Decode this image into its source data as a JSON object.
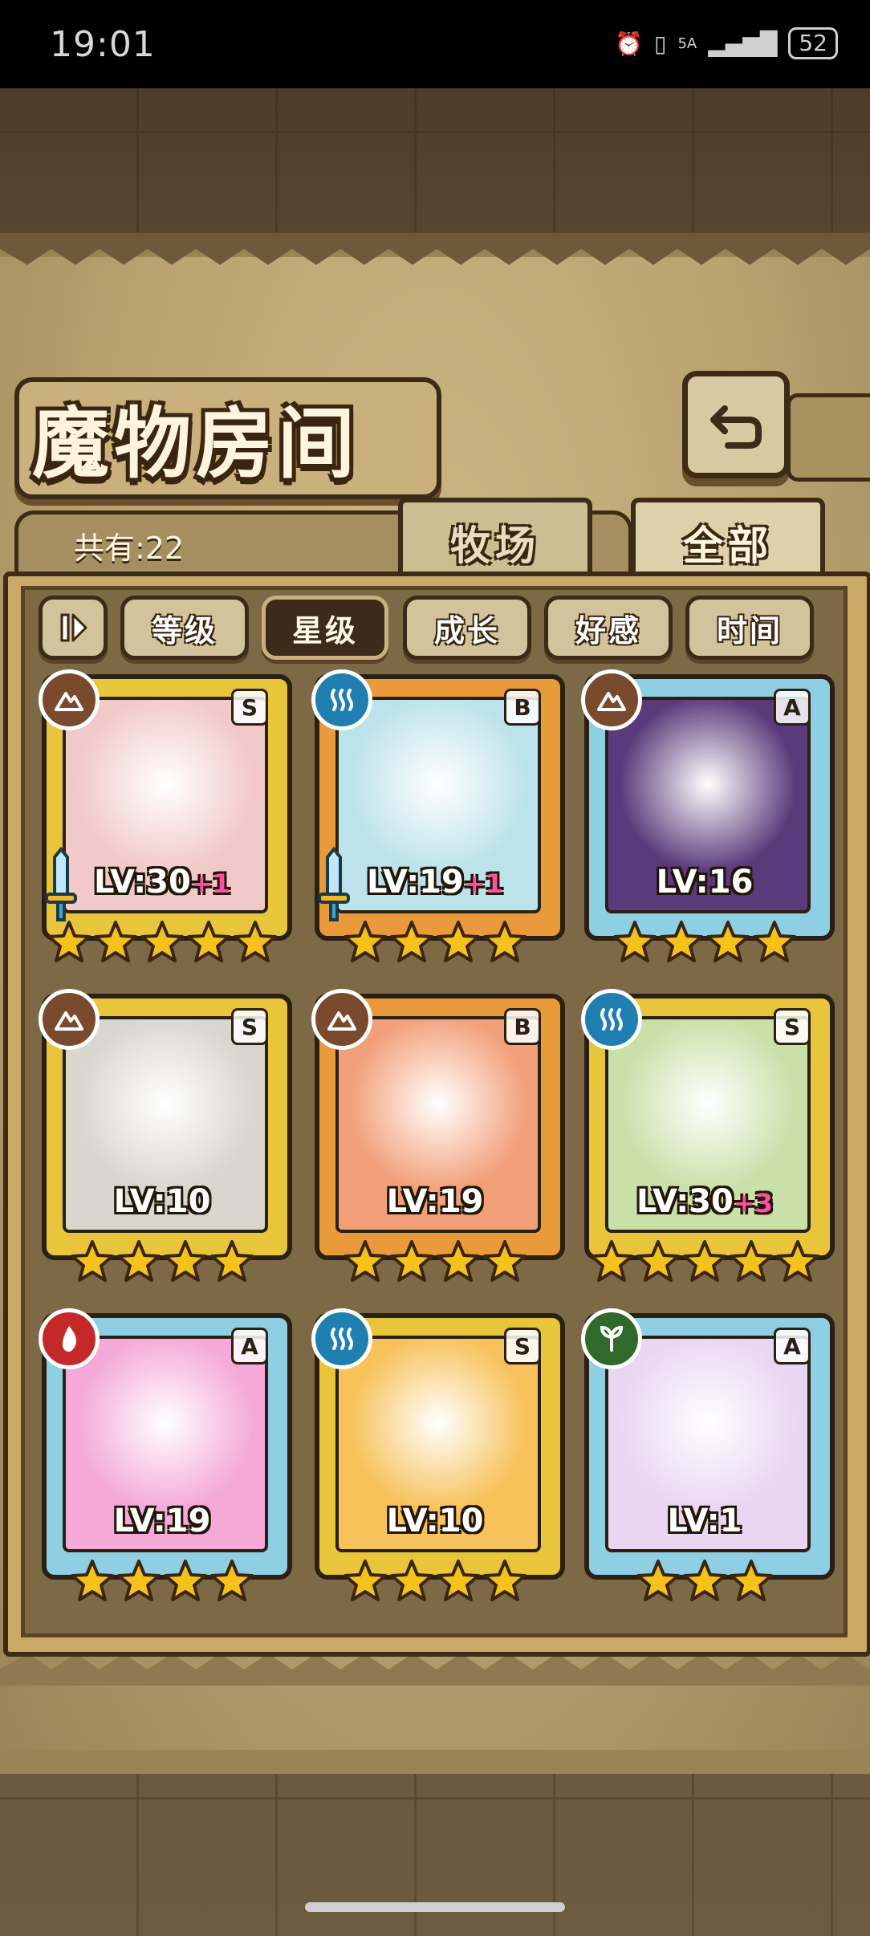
{
  "status_bar": {
    "time": "19:01",
    "network": "5A",
    "battery": "52"
  },
  "header": {
    "title": "魔物房间"
  },
  "summary": {
    "count_label": "共有:22"
  },
  "tabs": [
    {
      "label": "牧场",
      "active": false
    },
    {
      "label": "全部",
      "active": true
    }
  ],
  "sort": {
    "buttons": [
      {
        "label": "等级",
        "active": false
      },
      {
        "label": "星级",
        "active": true
      },
      {
        "label": "成长",
        "active": false
      },
      {
        "label": "好感",
        "active": false
      },
      {
        "label": "时间",
        "active": false
      }
    ]
  },
  "monsters": [
    {
      "level": "LV:30",
      "bonus": "+1",
      "rank": "S",
      "element": "earth",
      "stars": 5,
      "has_weapon": true,
      "frame_color": "#e8c53a",
      "art_color": "#f2c9c9"
    },
    {
      "level": "LV:19",
      "bonus": "+1",
      "rank": "B",
      "element": "water",
      "stars": 4,
      "has_weapon": true,
      "frame_color": "#e99a3a",
      "art_color": "#bde3ea"
    },
    {
      "level": "LV:16",
      "bonus": "",
      "rank": "A",
      "element": "earth",
      "stars": 4,
      "has_weapon": false,
      "frame_color": "#8fcfe3",
      "art_color": "#5a3a7a"
    },
    {
      "level": "LV:10",
      "bonus": "",
      "rank": "S",
      "element": "earth",
      "stars": 4,
      "has_weapon": false,
      "frame_color": "#e8c53a",
      "art_color": "#d9d6cf"
    },
    {
      "level": "LV:19",
      "bonus": "",
      "rank": "B",
      "element": "earth",
      "stars": 4,
      "has_weapon": false,
      "frame_color": "#e99a3a",
      "art_color": "#f2a07a"
    },
    {
      "level": "LV:30",
      "bonus": "+3",
      "rank": "S",
      "element": "water",
      "stars": 5,
      "has_weapon": false,
      "frame_color": "#e8c53a",
      "art_color": "#c9e0a8"
    },
    {
      "level": "LV:19",
      "bonus": "",
      "rank": "A",
      "element": "fire",
      "stars": 4,
      "has_weapon": false,
      "frame_color": "#8fcfe3",
      "art_color": "#f4a9d8"
    },
    {
      "level": "LV:10",
      "bonus": "",
      "rank": "S",
      "element": "water",
      "stars": 4,
      "has_weapon": false,
      "frame_color": "#e8c53a",
      "art_color": "#f7c25a"
    },
    {
      "level": "LV:1",
      "bonus": "",
      "rank": "A",
      "element": "wood",
      "stars": 3,
      "has_weapon": false,
      "frame_color": "#8fcfe3",
      "art_color": "#e9d6f3"
    }
  ],
  "colors": {
    "earth": "#7a4a2e",
    "water": "#1f7fb0",
    "fire": "#c4292a",
    "wood": "#2f6a2a",
    "star": "#f5c21c"
  }
}
